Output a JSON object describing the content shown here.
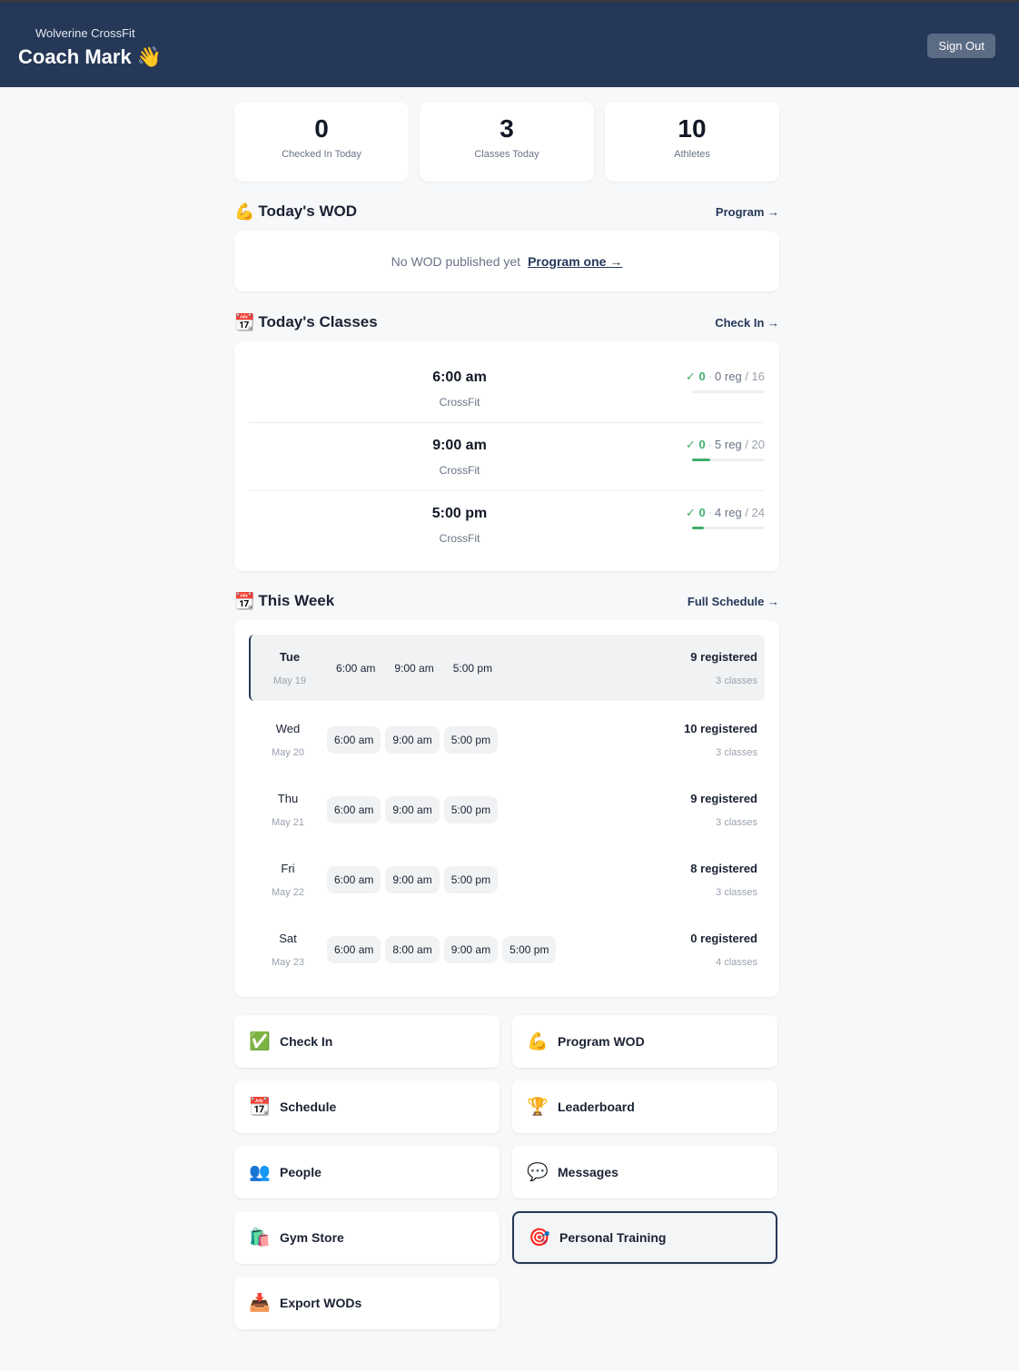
{
  "header": {
    "gym_name": "Wolverine CrossFit",
    "coach_name": "Coach Mark 👋",
    "sign_out": "Sign Out"
  },
  "stats": [
    {
      "value": "0",
      "label": "Checked In Today"
    },
    {
      "value": "3",
      "label": "Classes Today"
    },
    {
      "value": "10",
      "label": "Athletes"
    }
  ],
  "wod": {
    "icon": "💪",
    "title": "Today's WOD",
    "link": "Program →",
    "empty_text": "No WOD published yet",
    "empty_link": "Program one →"
  },
  "classes": {
    "icon": "📆",
    "title": "Today's Classes",
    "link": "Check In →",
    "items": [
      {
        "time": "6:00 am",
        "type": "CrossFit",
        "checked": "✓ 0",
        "reg": "0 reg",
        "cap": "/ 16",
        "fill_fraction": 0
      },
      {
        "time": "9:00 am",
        "type": "CrossFit",
        "checked": "✓ 0",
        "reg": "5 reg",
        "cap": "/ 20",
        "fill_fraction": 0.25
      },
      {
        "time": "5:00 pm",
        "type": "CrossFit",
        "checked": "✓ 0",
        "reg": "4 reg",
        "cap": "/ 24",
        "fill_fraction": 0.167
      }
    ]
  },
  "week": {
    "icon": "📆",
    "title": "This Week",
    "link": "Full Schedule →",
    "days": [
      {
        "day": "Tue",
        "date": "May 19",
        "times": [
          "6:00 am",
          "9:00 am",
          "5:00 pm"
        ],
        "registered": "9 registered",
        "classes": "3 classes",
        "today": true
      },
      {
        "day": "Wed",
        "date": "May 20",
        "times": [
          "6:00 am",
          "9:00 am",
          "5:00 pm"
        ],
        "registered": "10 registered",
        "classes": "3 classes",
        "today": false
      },
      {
        "day": "Thu",
        "date": "May 21",
        "times": [
          "6:00 am",
          "9:00 am",
          "5:00 pm"
        ],
        "registered": "9 registered",
        "classes": "3 classes",
        "today": false
      },
      {
        "day": "Fri",
        "date": "May 22",
        "times": [
          "6:00 am",
          "9:00 am",
          "5:00 pm"
        ],
        "registered": "8 registered",
        "classes": "3 classes",
        "today": false
      },
      {
        "day": "Sat",
        "date": "May 23",
        "times": [
          "6:00 am",
          "8:00 am",
          "9:00 am",
          "5:00 pm"
        ],
        "registered": "0 registered",
        "classes": "4 classes",
        "today": false
      }
    ]
  },
  "actions": [
    {
      "icon": "✅",
      "label": "Check In",
      "name": "check-in",
      "icon_name": "check-box-icon"
    },
    {
      "icon": "💪",
      "label": "Program WOD",
      "name": "program-wod",
      "icon_name": "flexed-biceps-icon"
    },
    {
      "icon": "📆",
      "label": "Schedule",
      "name": "schedule",
      "icon_name": "calendar-icon"
    },
    {
      "icon": "🏆",
      "label": "Leaderboard",
      "name": "leaderboard",
      "icon_name": "trophy-icon"
    },
    {
      "icon": "👥",
      "label": "People",
      "name": "people",
      "icon_name": "people-icon"
    },
    {
      "icon": "💬",
      "label": "Messages",
      "name": "messages",
      "icon_name": "speech-bubble-icon"
    },
    {
      "icon": "🛍️",
      "label": "Gym Store",
      "name": "gym-store",
      "icon_name": "shopping-bags-icon"
    },
    {
      "icon": "🎯",
      "label": "Personal Training",
      "name": "personal-training",
      "icon_name": "target-icon",
      "selected": true
    },
    {
      "icon": "📥",
      "label": "Export WODs",
      "name": "export-wods",
      "icon_name": "inbox-tray-icon"
    }
  ],
  "colors": {
    "header_bg": "#253858",
    "accent_green": "#3fae6a",
    "page_bg": "#f7f8fa"
  }
}
